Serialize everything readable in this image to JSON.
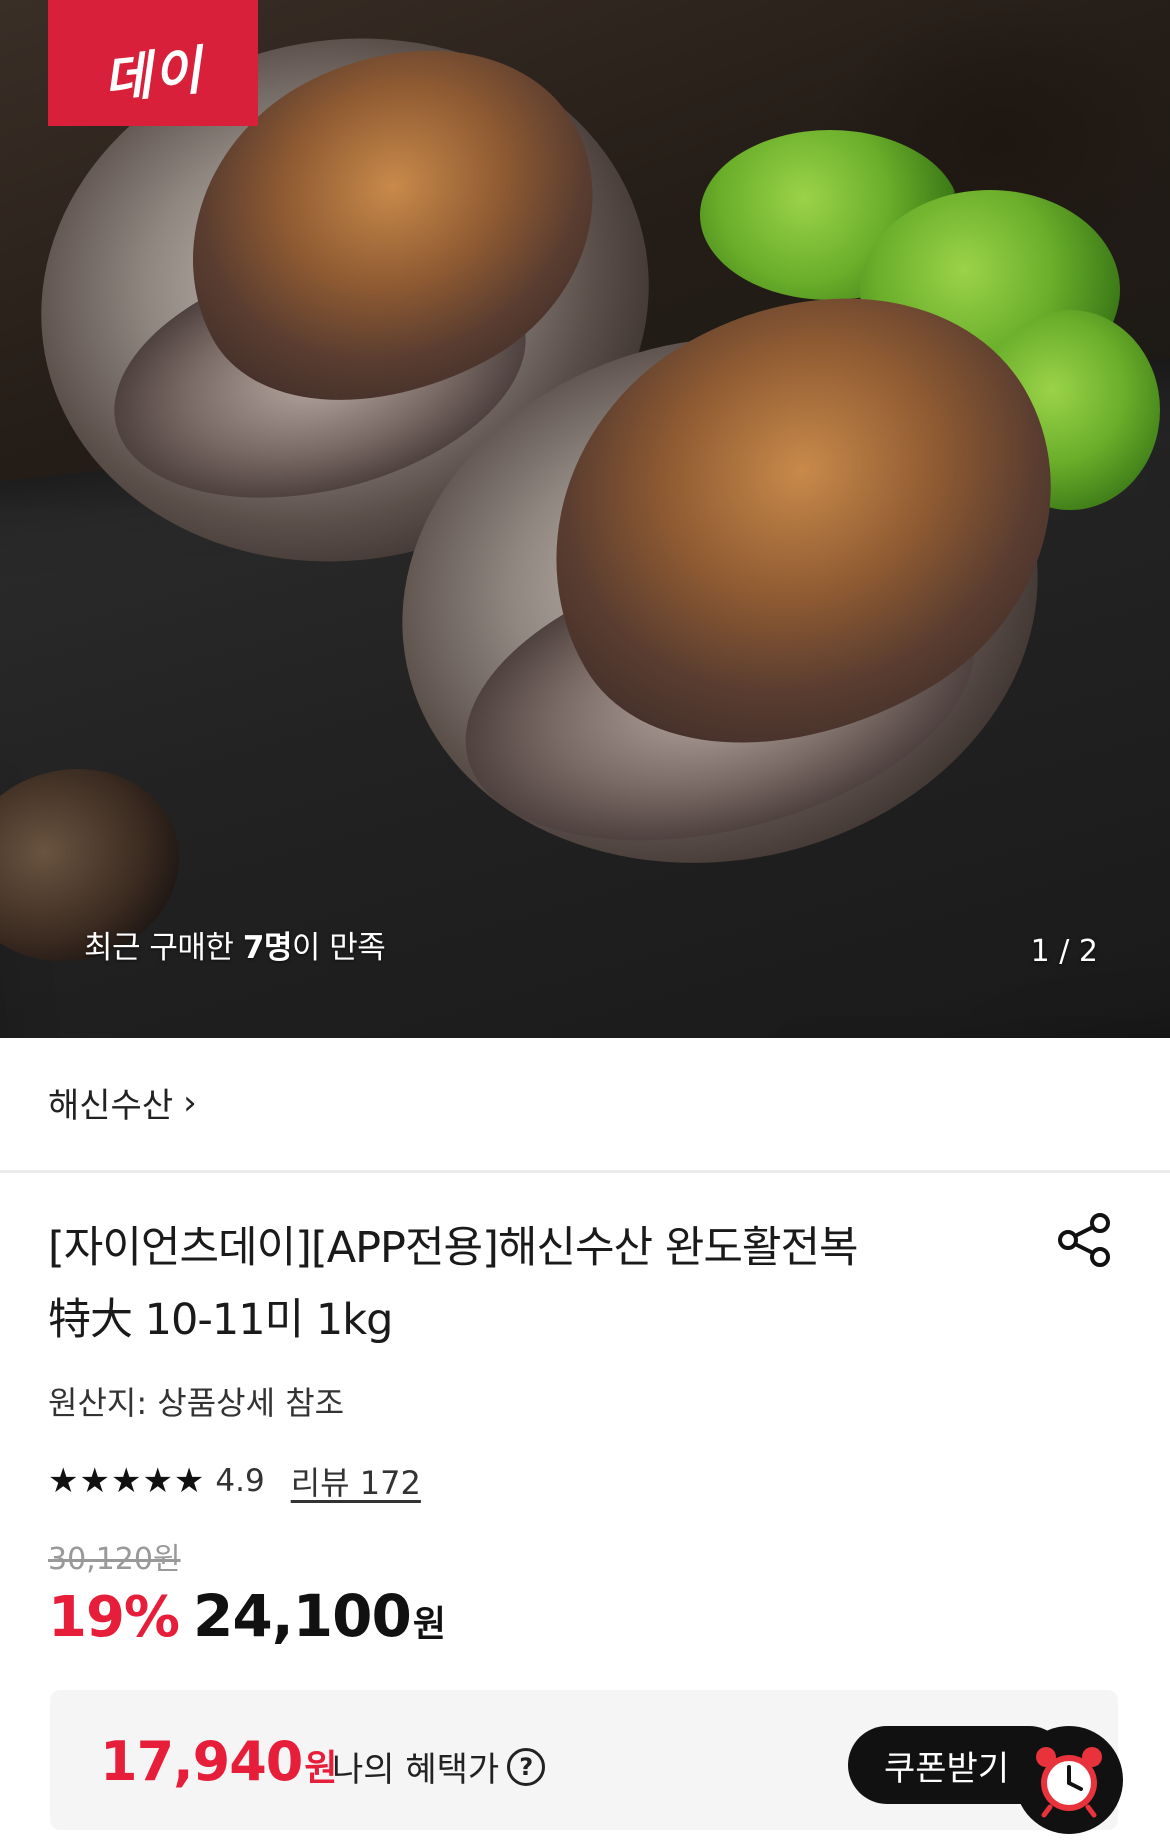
{
  "hero": {
    "brand_badge": "데이",
    "caption_prefix": "최근 구매한 ",
    "caption_count": "7명",
    "caption_suffix": "이 만족",
    "pager": "1 / 2"
  },
  "seller": {
    "name": "해신수산",
    "chevron": "›"
  },
  "product": {
    "title_line1": "[자이언츠데이][APP전용]해신수산 완도활전복",
    "title_line2": "特大 10-11미 1kg",
    "origin": "원산지: 상품상세 참조",
    "rating_stars": "★★★★★",
    "rating_score": "4.9",
    "review_link": "리뷰 172",
    "original_price": "30,120원",
    "discount": "19%",
    "price": "24,100",
    "price_unit": "원"
  },
  "benefit": {
    "price": "17,940",
    "price_unit": "원",
    "label": "나의 혜택가",
    "help": "?",
    "coupon_button": "쿠폰받기"
  },
  "colors": {
    "accent_red": "#e61e3a",
    "badge_red": "#d8203a",
    "benefit_bg": "#f5f5f6"
  },
  "icons": {
    "share": "share-icon",
    "help": "question-circle-icon",
    "clock": "alarm-clock-icon",
    "chevron": "chevron-right-icon"
  }
}
